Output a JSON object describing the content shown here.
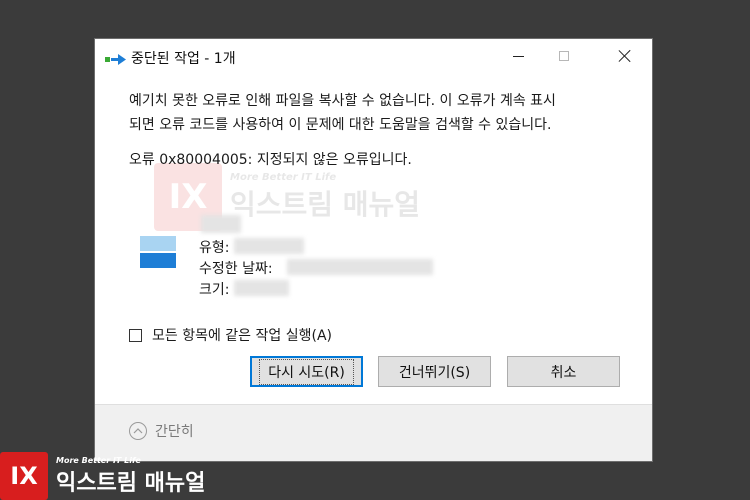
{
  "dialog": {
    "title": "중단된 작업 - 1개",
    "message_line1": "예기치 못한 오류로 인해 파일을 복사할 수 없습니다. 이 오류가 계속 표시",
    "message_line2": "되면 오류 코드를 사용하여 이 문제에 대한 도움말을 검색할 수 있습니다.",
    "error": "오류 0x80004005: 지정되지 않은 오류입니다.",
    "file": {
      "type_label": "유형:",
      "modified_label": "수정한 날짜:",
      "size_label": "크기:"
    },
    "checkbox_label": "모든 항목에 같은 작업 실행(A)",
    "checkbox_checked": false,
    "buttons": {
      "retry": "다시 시도(R)",
      "skip": "건너뛰기(S)",
      "cancel": "취소"
    },
    "collapse_label": "간단히"
  },
  "watermark": {
    "logo": "IX",
    "tagline": "More Better IT Life",
    "name": "익스트림 매뉴얼"
  },
  "colors": {
    "background": "#3b3b3b",
    "accent": "#0078d7",
    "logo_red": "#d81e1e"
  }
}
